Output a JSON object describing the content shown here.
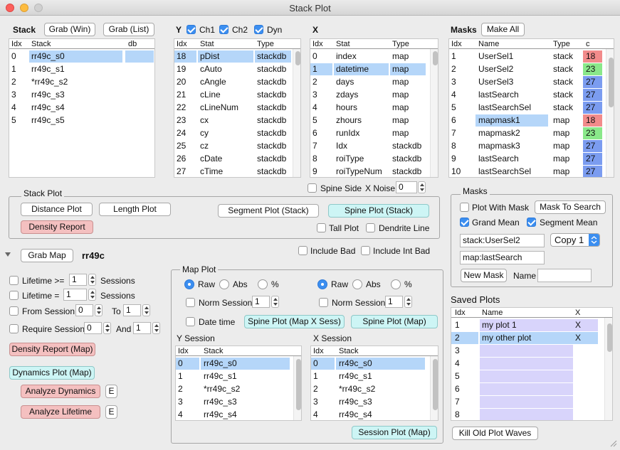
{
  "window": {
    "title": "Stack Plot"
  },
  "stack": {
    "label": "Stack",
    "grab_win": "Grab (Win)",
    "grab_list": "Grab (List)",
    "cols": [
      "Idx",
      "Stack",
      "db"
    ],
    "rows": [
      [
        "0",
        "rr49c_s0"
      ],
      [
        "1",
        "rr49c_s1"
      ],
      [
        "2",
        "*rr49c_s2"
      ],
      [
        "3",
        "rr49c_s3"
      ],
      [
        "4",
        "rr49c_s4"
      ],
      [
        "5",
        "rr49c_s5"
      ]
    ]
  },
  "y": {
    "label": "Y",
    "ch1": "Ch1",
    "ch2": "Ch2",
    "dyn": "Dyn",
    "cols": [
      "Idx",
      "Stat",
      "Type"
    ],
    "rows": [
      [
        "18",
        "pDist",
        "stackdb"
      ],
      [
        "19",
        "cAuto",
        "stackdb"
      ],
      [
        "20",
        "cAngle",
        "stackdb"
      ],
      [
        "21",
        "cLine",
        "stackdb"
      ],
      [
        "22",
        "cLineNum",
        "stackdb"
      ],
      [
        "23",
        "cx",
        "stackdb"
      ],
      [
        "24",
        "cy",
        "stackdb"
      ],
      [
        "25",
        "cz",
        "stackdb"
      ],
      [
        "26",
        "cDate",
        "stackdb"
      ],
      [
        "27",
        "cTime",
        "stackdb"
      ]
    ]
  },
  "x": {
    "label": "X",
    "cols": [
      "Idx",
      "Stat",
      "Type"
    ],
    "rows": [
      [
        "0",
        "index",
        "map"
      ],
      [
        "1",
        "datetime",
        "map"
      ],
      [
        "2",
        "days",
        "map"
      ],
      [
        "3",
        "zdays",
        "map"
      ],
      [
        "4",
        "hours",
        "map"
      ],
      [
        "5",
        "zhours",
        "map"
      ],
      [
        "6",
        "runIdx",
        "map"
      ],
      [
        "7",
        "Idx",
        "stackdb"
      ],
      [
        "8",
        "roiType",
        "stackdb"
      ],
      [
        "9",
        "roiTypeNum",
        "stackdb"
      ]
    ]
  },
  "masks": {
    "label": "Masks",
    "make_all": "Make All",
    "cols": [
      "Idx",
      "Name",
      "Type",
      "c"
    ],
    "rows": [
      {
        "idx": "1",
        "name": "UserSel1",
        "type": "stack",
        "c": "18",
        "color": "#f28b8b"
      },
      {
        "idx": "2",
        "name": "UserSel2",
        "type": "stack",
        "c": "23",
        "color": "#8ae88a"
      },
      {
        "idx": "3",
        "name": "UserSel3",
        "type": "stack",
        "c": "27",
        "color": "#7b9cf0"
      },
      {
        "idx": "4",
        "name": "lastSearch",
        "type": "stack",
        "c": "27",
        "color": "#7b9cf0"
      },
      {
        "idx": "5",
        "name": "lastSearchSel",
        "type": "stack",
        "c": "27",
        "color": "#7b9cf0"
      },
      {
        "idx": "6",
        "name": "mapmask1",
        "type": "map",
        "c": "18",
        "color": "#f28b8b"
      },
      {
        "idx": "7",
        "name": "mapmask2",
        "type": "map",
        "c": "23",
        "color": "#8ae88a"
      },
      {
        "idx": "8",
        "name": "mapmask3",
        "type": "map",
        "c": "27",
        "color": "#7b9cf0"
      },
      {
        "idx": "9",
        "name": "lastSearch",
        "type": "map",
        "c": "27",
        "color": "#7b9cf0"
      },
      {
        "idx": "10",
        "name": "lastSearchSel",
        "type": "map",
        "c": "27",
        "color": "#7b9cf0"
      }
    ]
  },
  "spine": {
    "side": "Spine Side",
    "xnoise": "X Noise",
    "xnoise_val": "0"
  },
  "stackplot": {
    "title": "Stack Plot",
    "distance": "Distance Plot",
    "length": "Length Plot",
    "segment": "Segment Plot (Stack)",
    "spineplot": "Spine Plot (Stack)",
    "density": "Density Report",
    "tall": "Tall Plot",
    "dendrite": "Dendrite Line"
  },
  "maskspanel": {
    "title": "Masks",
    "plot_with_mask": "Plot With Mask",
    "mask_to_search": "Mask To Search",
    "grand_mean": "Grand Mean",
    "segment_mean": "Segment Mean",
    "stack_field": "stack:UserSel2",
    "copy_value": "Copy 1",
    "map_field": "map:lastSearch",
    "new_mask": "New Mask",
    "name_label": "Name",
    "name_value": ""
  },
  "grabmap": {
    "button": "Grab Map",
    "name": "rr49c"
  },
  "include": {
    "bad": "Include Bad",
    "intbad": "Include Int Bad"
  },
  "left": {
    "lifetime_ge": "Lifetime >=",
    "lifetime_ge_val": "1",
    "lifetime_eq": "Lifetime =",
    "lifetime_eq_val": "1",
    "sessions": "Sessions",
    "from_session": "From Session",
    "from_val": "0",
    "to": "To",
    "to_val": "1",
    "require_session": "Require Session",
    "req_val": "0",
    "and": "And",
    "and_val": "1",
    "density_map": "Density Report (Map)",
    "dynamics_map": "Dynamics Plot (Map)",
    "analyze_dynamics": "Analyze Dynamics",
    "analyze_lifetime": "Analyze Lifetime",
    "e": "E"
  },
  "mapplot": {
    "title": "Map Plot",
    "raw": "Raw",
    "abs": "Abs",
    "pct": "%",
    "norm_session": "Norm Session",
    "norm_val": "1",
    "date_time": "Date time",
    "spine_xsess": "Spine Plot (Map X Sess)",
    "spine_map": "Spine Plot (Map)",
    "ysession": "Y Session",
    "xsession": "X Session",
    "cols": [
      "Idx",
      "Stack"
    ],
    "rows": [
      [
        "0",
        "rr49c_s0"
      ],
      [
        "1",
        "rr49c_s1"
      ],
      [
        "2",
        "*rr49c_s2"
      ],
      [
        "3",
        "rr49c_s3"
      ],
      [
        "4",
        "rr49c_s4"
      ]
    ],
    "session_plot": "Session Plot (Map)"
  },
  "saved": {
    "title": "Saved Plots",
    "cols": [
      "Idx",
      "Name",
      "X"
    ],
    "rows": [
      [
        "1",
        "my plot 1",
        "X"
      ],
      [
        "2",
        "my other plot",
        "X"
      ],
      [
        "3",
        "",
        ""
      ],
      [
        "4",
        "",
        ""
      ],
      [
        "5",
        "",
        ""
      ],
      [
        "6",
        "",
        ""
      ],
      [
        "7",
        "",
        ""
      ],
      [
        "8",
        "",
        ""
      ]
    ],
    "kill": "Kill Old Plot Waves"
  }
}
